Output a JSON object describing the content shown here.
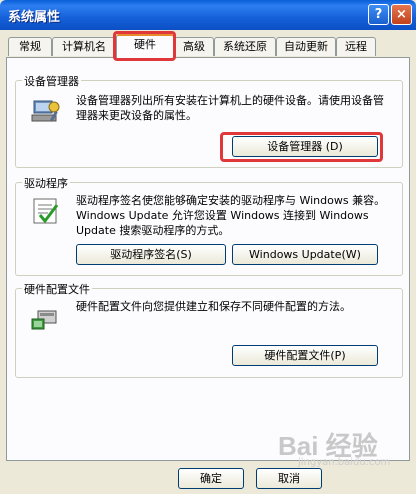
{
  "window": {
    "title": "系统属性",
    "help_glyph": "?",
    "close_glyph": "×"
  },
  "tabs": [
    {
      "label": "常规"
    },
    {
      "label": "计算机名"
    },
    {
      "label": "硬件",
      "active": true
    },
    {
      "label": "高级"
    },
    {
      "label": "系统还原"
    },
    {
      "label": "自动更新"
    },
    {
      "label": "远程"
    }
  ],
  "device_manager": {
    "group_label": "设备管理器",
    "description": "设备管理器列出所有安装在计算机上的硬件设备。请使用设备管理器来更改设备的属性。",
    "button": "设备管理器 (D)"
  },
  "drivers": {
    "group_label": "驱动程序",
    "description": "驱动程序签名使您能够确定安装的驱动程序与 Windows 兼容。Windows Update 允许您设置 Windows 连接到 Windows Update 搜索驱动程序的方式。",
    "signing_button": "驱动程序签名(S)",
    "update_button": "Windows Update(W)"
  },
  "hardware_profiles": {
    "group_label": "硬件配置文件",
    "description": "硬件配置文件向您提供建立和保存不同硬件配置的方法。",
    "button": "硬件配置文件(P)"
  },
  "footer": {
    "ok": "确定",
    "cancel": "取消"
  },
  "watermark": {
    "brand": "Bai 经验",
    "url": "jingyan.baidu.com"
  },
  "colors": {
    "highlight": "#e0383a",
    "titlebar": "#1560d9"
  }
}
